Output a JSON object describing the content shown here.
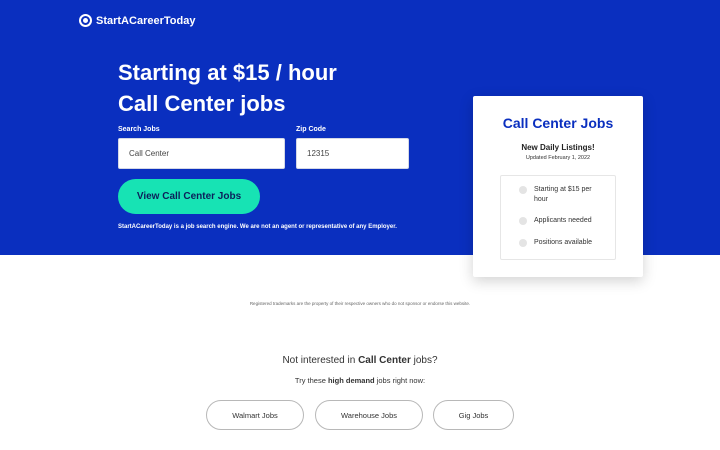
{
  "brand": {
    "name": "StartACareerToday",
    "icon": "chat-search-icon"
  },
  "hero": {
    "line1": "Starting at $15 / hour",
    "line2": "Call Center jobs",
    "search_label": "Search Jobs",
    "search_value": "Call Center",
    "zip_label": "Zip Code",
    "zip_value": "12315",
    "cta_label": "View Call Center Jobs",
    "disclaimer": "StartACareerToday is a job search engine. We are not an agent or representative of any Employer.",
    "background_color": "#0a2fbf",
    "cta_color": "#17e3b4"
  },
  "card": {
    "title": "Call Center Jobs",
    "subtitle": "New Daily Listings!",
    "updated": "Updated February 1, 2022",
    "items": [
      {
        "label": "Starting at $15 per hour",
        "icon": "radio-dot-icon"
      },
      {
        "label": "Applicants needed",
        "icon": "radio-dot-icon"
      },
      {
        "label": "Positions available",
        "icon": "radio-dot-icon"
      }
    ]
  },
  "footer": {
    "trademark": "Registered trademarks are the property of their respective owners who do not sponsor or endorse this website.",
    "not_interested_pre": "Not interested in ",
    "not_interested_job": "Call Center",
    "not_interested_post": " jobs?",
    "try_pre": "Try these ",
    "try_bold": "high demand",
    "try_post": " jobs right now:",
    "alternatives": [
      "Walmart Jobs",
      "Warehouse Jobs",
      "Gig Jobs"
    ]
  }
}
